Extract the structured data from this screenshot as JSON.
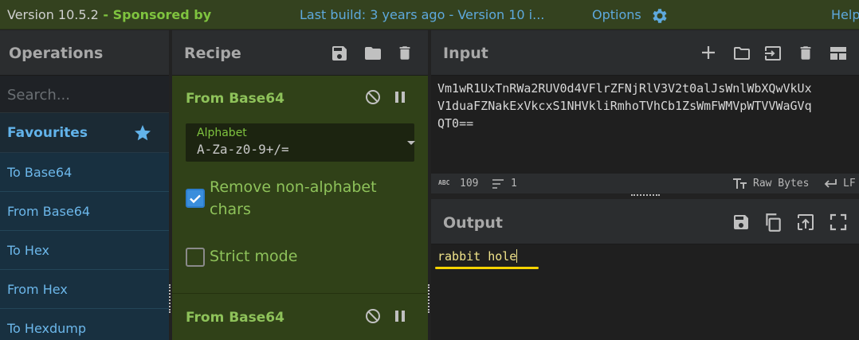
{
  "banner": {
    "version": "Version 10.5.2",
    "sponsored": " - Sponsored by",
    "last_build": "Last build: 3 years ago - Version 10 i...",
    "options": "Options",
    "help": "Help"
  },
  "operations": {
    "title": "Operations",
    "search_placeholder": "Search...",
    "favourites": "Favourites",
    "items": [
      "To Base64",
      "From Base64",
      "To Hex",
      "From Hex",
      "To Hexdump"
    ]
  },
  "recipe": {
    "title": "Recipe",
    "ingredients": [
      {
        "name": "From Base64",
        "alphabet_label": "Alphabet",
        "alphabet_value": "A-Za-z0-9+/=",
        "remove_nonalpha_line1": "Remove non-alphabet",
        "remove_nonalpha_line2": "chars",
        "remove_nonalpha_checked": true,
        "strict_mode": "Strict mode",
        "strict_mode_checked": false
      },
      {
        "name": "From Base64"
      }
    ]
  },
  "input": {
    "title": "Input",
    "text": "Vm1wR1UxTnRWa2RUV0d4VFlrZFNjRlV3V2t0alJsWnlWbXQwVkUx\nV1duaFZNakExVkcxS1NHVkliRmhoTVhCb1ZsWmFWMVpWTVVWaGVq\nQT0==",
    "status": {
      "abc_badge": "ABC",
      "length": "109",
      "lines": "1",
      "raw_bytes": "Raw Bytes",
      "eol": "LF"
    }
  },
  "output": {
    "title": "Output",
    "text": "rabbit hole"
  },
  "colors": {
    "banner_bg": "#34421f",
    "recipe_bg": "#304118",
    "ops_item_bg": "#183040",
    "accent_blue": "#62b3ea",
    "accent_green": "#8ec25a",
    "output_text": "#f0e38a",
    "highlight": "#f5d300"
  }
}
